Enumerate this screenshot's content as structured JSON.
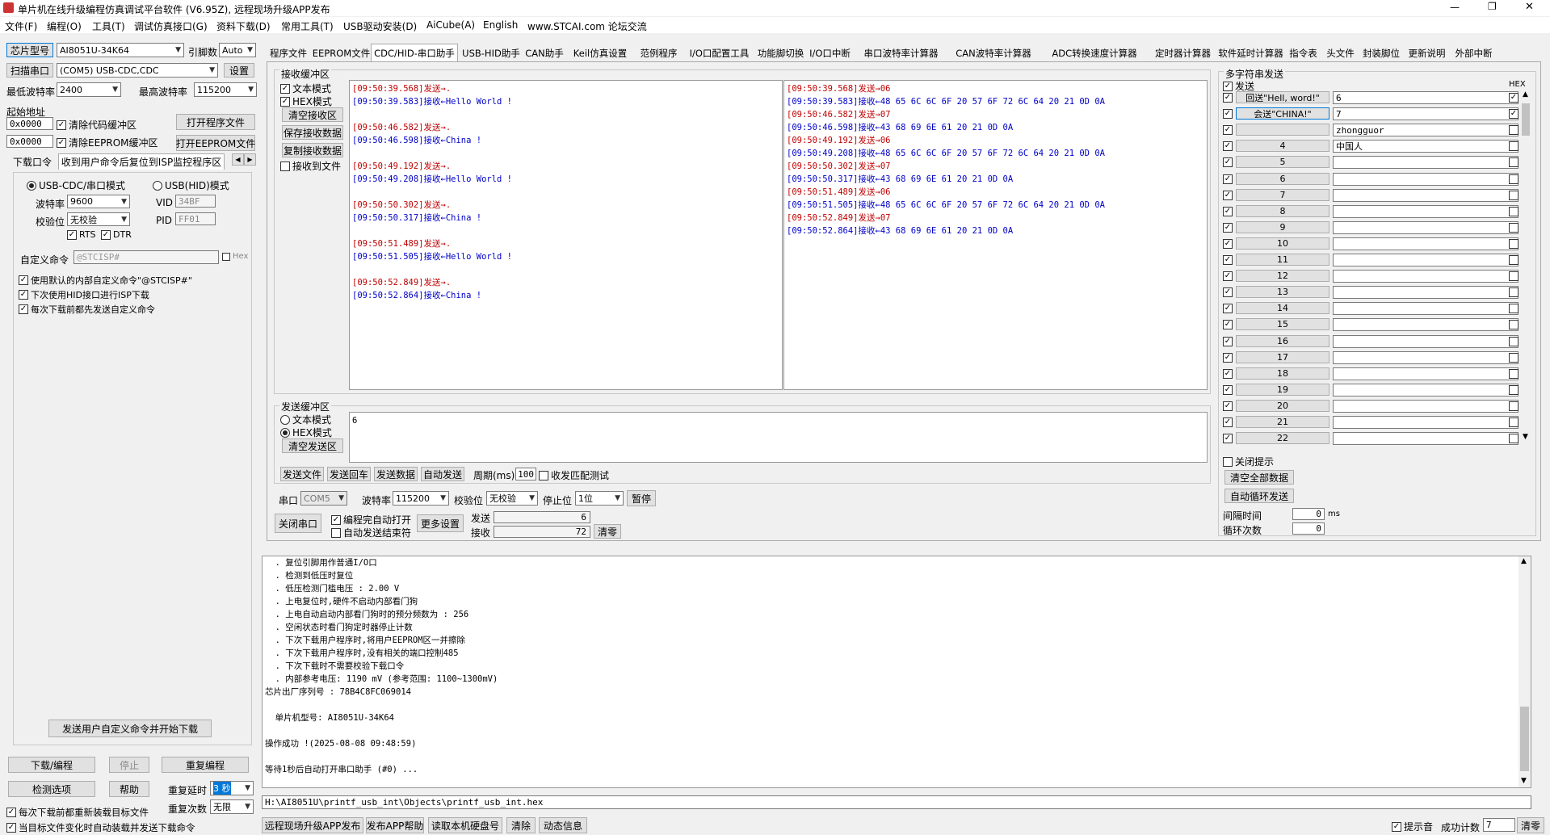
{
  "window": {
    "title": "单片机在线升级编程仿真调试平台软件 (V6.95Z), 远程现场升级APP发布",
    "controls": {
      "minimize": "—",
      "maximize": "❐",
      "close": "✕"
    }
  },
  "menu": [
    "文件(F)",
    "编程(O)",
    "工具(T)",
    "调试仿真接口(G)",
    "资料下载(D)",
    "常用工具(T)",
    "USB驱动安装(D)",
    "AiCube(A)",
    "English",
    "www.STCAI.com 论坛交流"
  ],
  "left": {
    "chip_btn": "芯片型号",
    "chip_value": "AI8051U-34K64",
    "pin_label": "引脚数",
    "pin_value": "Auto",
    "scan_btn": "扫描串口",
    "port_value": "(COM5) USB-CDC,CDC",
    "settings_btn": "设置",
    "min_baud_label": "最低波特率",
    "min_baud_value": "2400",
    "max_baud_label": "最高波特率",
    "max_baud_value": "115200",
    "start_addr_label": "起始地址",
    "addr1": "0x0000",
    "clear_code": "清除代码缓冲区",
    "open_prog": "打开程序文件",
    "addr2": "0x0000",
    "clear_eeprom": "清除EEPROM缓冲区",
    "open_eeprom": "打开EEPROM文件",
    "tab_download": "下载口令",
    "tab_isp": "收到用户命令后复位到ISP监控程序区",
    "usb_cdc_mode": "USB-CDC/串口模式",
    "usb_hid_mode": "USB(HID)模式",
    "baud_label": "波特率",
    "baud_value": "9600",
    "vid_label": "VID",
    "vid_value": "34BF",
    "parity_label": "校验位",
    "parity_value": "无校验",
    "pid_label": "PID",
    "pid_value": "FF01",
    "rts": "RTS",
    "dtr": "DTR",
    "custom_cmd_label": "自定义命令",
    "custom_cmd_placeholder": "@STCISP#",
    "hex_label": "Hex",
    "opt1": "使用默认的内部自定义命令\"@STCISP#\"",
    "opt2": "下次使用HID接口进行ISP下载",
    "opt3": "每次下载前都先发送自定义命令",
    "send_custom_btn": "发送用户自定义命令并开始下载",
    "download_btn": "下载/编程",
    "stop_btn": "停止",
    "reprog_btn": "重复编程",
    "check_btn": "检测选项",
    "help_btn": "帮助",
    "delay_label": "重复延时",
    "delay_value": "3 秒",
    "count_label": "重复次数",
    "count_value": "无限",
    "reload_opt": "每次下载前都重新装载目标文件",
    "auto_opt": "当目标文件变化时自动装载并发送下载命令"
  },
  "tabs": [
    "程序文件",
    "EEPROM文件",
    "CDC/HID-串口助手",
    "USB-HID助手",
    "CAN助手",
    "Keil仿真设置",
    "范例程序",
    "I/O口配置工具",
    "功能脚切换",
    "I/O口中断",
    "串口波特率计算器",
    "CAN波特率计算器",
    "ADC转换速度计算器",
    "定时器计算器",
    "软件延时计算器",
    "指令表",
    "头文件",
    "封装脚位",
    "更新说明",
    "外部中断"
  ],
  "active_tab": "CDC/HID-串口助手",
  "recv": {
    "title": "接收缓冲区",
    "text_mode": "文本模式",
    "hex_mode": "HEX模式",
    "clear_btn": "清空接收区",
    "save_btn": "保存接收数据",
    "copy_btn": "复制接收数据",
    "to_file": "接收到文件",
    "text_log": [
      {
        "t": "tx",
        "s": "[09:50:39.568]发送→."
      },
      {
        "t": "rx",
        "s": "[09:50:39.583]接收←Hello World !"
      },
      {
        "t": "gap",
        "s": ""
      },
      {
        "t": "tx",
        "s": "[09:50:46.582]发送→."
      },
      {
        "t": "rx",
        "s": "[09:50:46.598]接收←China !"
      },
      {
        "t": "gap",
        "s": ""
      },
      {
        "t": "tx",
        "s": "[09:50:49.192]发送→."
      },
      {
        "t": "rx",
        "s": "[09:50:49.208]接收←Hello World !"
      },
      {
        "t": "gap",
        "s": ""
      },
      {
        "t": "tx",
        "s": "[09:50:50.302]发送→."
      },
      {
        "t": "rx",
        "s": "[09:50:50.317]接收←China !"
      },
      {
        "t": "gap",
        "s": ""
      },
      {
        "t": "tx",
        "s": "[09:50:51.489]发送→."
      },
      {
        "t": "rx",
        "s": "[09:50:51.505]接收←Hello World !"
      },
      {
        "t": "gap",
        "s": ""
      },
      {
        "t": "tx",
        "s": "[09:50:52.849]发送→."
      },
      {
        "t": "rx",
        "s": "[09:50:52.864]接收←China !"
      }
    ],
    "hex_log": [
      {
        "t": "tx",
        "s": "[09:50:39.568]发送→06"
      },
      {
        "t": "rx",
        "s": "[09:50:39.583]接收←48 65 6C 6C 6F 20 57 6F 72 6C 64 20 21 0D 0A"
      },
      {
        "t": "tx",
        "s": "[09:50:46.582]发送→07"
      },
      {
        "t": "rx",
        "s": "[09:50:46.598]接收←43 68 69 6E 61 20 21 0D 0A"
      },
      {
        "t": "tx",
        "s": "[09:50:49.192]发送→06"
      },
      {
        "t": "rx",
        "s": "[09:50:49.208]接收←48 65 6C 6C 6F 20 57 6F 72 6C 64 20 21 0D 0A"
      },
      {
        "t": "tx",
        "s": "[09:50:50.302]发送→07"
      },
      {
        "t": "rx",
        "s": "[09:50:50.317]接收←43 68 69 6E 61 20 21 0D 0A"
      },
      {
        "t": "tx",
        "s": "[09:50:51.489]发送→06"
      },
      {
        "t": "rx",
        "s": "[09:50:51.505]接收←48 65 6C 6C 6F 20 57 6F 72 6C 64 20 21 0D 0A"
      },
      {
        "t": "tx",
        "s": "[09:50:52.849]发送→07"
      },
      {
        "t": "rx",
        "s": "[09:50:52.864]接收←43 68 69 6E 61 20 21 0D 0A"
      }
    ]
  },
  "send": {
    "title": "发送缓冲区",
    "text_mode": "文本模式",
    "hex_mode": "HEX模式",
    "clear_btn": "清空发送区",
    "content": "6",
    "send_file": "发送文件",
    "send_enter": "发送回车",
    "send_data": "发送数据",
    "auto_send": "自动发送",
    "period_label": "周期(ms)",
    "period_value": "100",
    "match_test": "收发匹配测试"
  },
  "serial": {
    "port_label": "串口",
    "port_value": "COM5",
    "baud_label": "波特率",
    "baud_value": "115200",
    "parity_label": "校验位",
    "parity_value": "无校验",
    "stop_label": "停止位",
    "stop_value": "1位",
    "pause_btn": "暂停",
    "close_btn": "关闭串口",
    "auto_open": "编程完自动打开",
    "auto_end": "自动发送结束符",
    "more_btn": "更多设置",
    "tx_label": "发送",
    "tx_count": "6",
    "rx_label": "接收",
    "rx_count": "72",
    "zero_btn": "清零"
  },
  "multi": {
    "title": "多字符串发送",
    "send_label": "发送",
    "hex_label": "HEX",
    "rows": [
      {
        "btn": "回送\"Hell, word!\"",
        "val": "6",
        "hex": true
      },
      {
        "btn": "会送\"CHINA!\"",
        "val": "7",
        "hex": true
      },
      {
        "btn": "",
        "val": "zhongguor",
        "hex": false
      },
      {
        "btn": "4",
        "val": "中国人",
        "hex": false
      },
      {
        "btn": "5",
        "val": "",
        "hex": false
      },
      {
        "btn": "6",
        "val": "",
        "hex": false
      },
      {
        "btn": "7",
        "val": "",
        "hex": false
      },
      {
        "btn": "8",
        "val": "",
        "hex": false
      },
      {
        "btn": "9",
        "val": "",
        "hex": false
      },
      {
        "btn": "10",
        "val": "",
        "hex": false
      },
      {
        "btn": "11",
        "val": "",
        "hex": false
      },
      {
        "btn": "12",
        "val": "",
        "hex": false
      },
      {
        "btn": "13",
        "val": "",
        "hex": false
      },
      {
        "btn": "14",
        "val": "",
        "hex": false
      },
      {
        "btn": "15",
        "val": "",
        "hex": false
      },
      {
        "btn": "16",
        "val": "",
        "hex": false
      },
      {
        "btn": "17",
        "val": "",
        "hex": false
      },
      {
        "btn": "18",
        "val": "",
        "hex": false
      },
      {
        "btn": "19",
        "val": "",
        "hex": false
      },
      {
        "btn": "20",
        "val": "",
        "hex": false
      },
      {
        "btn": "21",
        "val": "",
        "hex": false
      },
      {
        "btn": "22",
        "val": "",
        "hex": false
      }
    ],
    "close_tip": "关闭提示",
    "clear_all": "清空全部数据",
    "auto_loop": "自动循环发送",
    "interval_label": "间隔时间",
    "interval_value": "0",
    "interval_unit": "ms",
    "loop_label": "循环次数",
    "loop_value": "0"
  },
  "status_log": [
    "  . 复位引脚用作普通I/O口",
    "  . 检测到低压时复位",
    "  . 低压检测门槛电压 : 2.00 V",
    "  . 上电复位时,硬件不启动内部看门狗",
    "  . 上电自动启动内部看门狗时的预分频数为 : 256",
    "  . 空闲状态时看门狗定时器停止计数",
    "  . 下次下载用户程序时,将用户EEPROM区一并擦除",
    "  . 下次下载用户程序时,没有相关的端口控制485",
    "  . 下次下载时不需要校验下载口令",
    "  . 内部参考电压: 1190 mV (参考范围: 1100~1300mV)",
    "芯片出厂序列号 : 78B4C8FC069014",
    "",
    "  单片机型号: AI8051U-34K64",
    "",
    "操作成功 !(2025-08-08 09:48:59)",
    "",
    "等待1秒后自动打开串口助手 (#0) ..."
  ],
  "file_path": "H:\\AI8051U\\printf_usb_int\\Objects\\printf_usb_int.hex",
  "bottom": {
    "remote_btn": "远程现场升级APP发布",
    "publish_btn": "发布APP帮助",
    "read_btn": "读取本机硬盘号",
    "clear_btn": "清除",
    "dynamic_btn": "动态信息",
    "tip_label": "提示音",
    "success_label": "成功计数",
    "success_value": "7",
    "zero_btn": "清零"
  }
}
